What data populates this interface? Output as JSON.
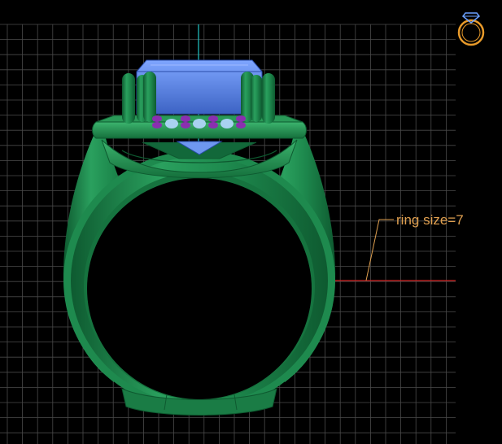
{
  "viewport": {
    "background": "#000000",
    "grid_color": "#4a4a4a",
    "grid_major_color": "#5c5c5c"
  },
  "colors": {
    "ring_metal": "#1e8a4e",
    "ring_metal_light": "#3cb46e",
    "ring_metal_dark": "#0e5a30",
    "center_stone": "#4a76d8",
    "center_stone_light": "#7fa6ff",
    "accent_stones": "#8a2fb0",
    "small_stones": "#a8d2f0",
    "axis_vertical": "#21c8c8",
    "axis_horizontal": "#d42020",
    "annotation": "#e0a050",
    "icon": "#e89a2a"
  },
  "annotation": {
    "label": "ring size=7"
  },
  "icons": {
    "view_cube": "ring-view-icon"
  }
}
